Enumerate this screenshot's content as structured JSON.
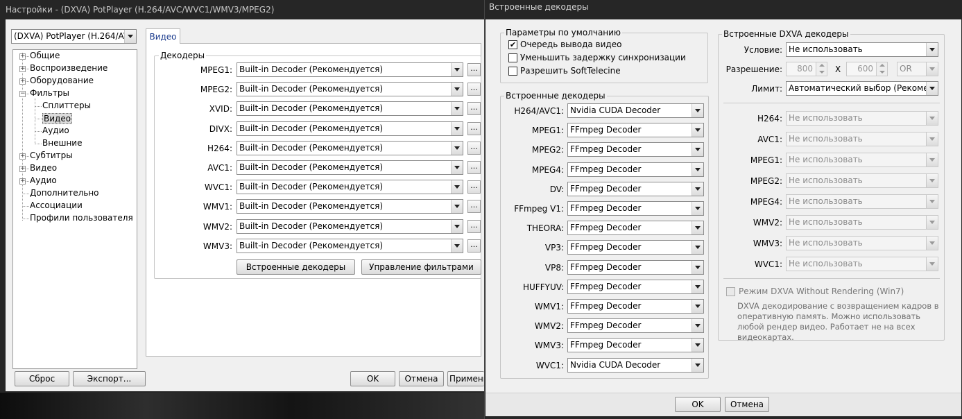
{
  "settings_window": {
    "title": "Настройки - (DXVA) PotPlayer (H.264/AVC/WVC1/WMV3/MPEG2)",
    "profile_select": "(DXVA) PotPlayer (H.264/AVC/",
    "tab_label": "Видео",
    "tree": [
      {
        "label": "Общие",
        "level": 0,
        "expander": "+"
      },
      {
        "label": "Воспроизведение",
        "level": 0,
        "expander": "+"
      },
      {
        "label": "Оборудование",
        "level": 0,
        "expander": "+"
      },
      {
        "label": "Фильтры",
        "level": 0,
        "expander": "-"
      },
      {
        "label": "Сплиттеры",
        "level": 1
      },
      {
        "label": "Видео",
        "level": 1,
        "selected": true
      },
      {
        "label": "Аудио",
        "level": 1
      },
      {
        "label": "Внешние",
        "level": 1
      },
      {
        "label": "Субтитры",
        "level": 0,
        "expander": "+"
      },
      {
        "label": "Видео",
        "level": 0,
        "expander": "+"
      },
      {
        "label": "Аудио",
        "level": 0,
        "expander": "+"
      },
      {
        "label": "Дополнительно",
        "level": 0
      },
      {
        "label": "Ассоциации",
        "level": 0
      },
      {
        "label": "Профили пользователя",
        "level": 0
      }
    ],
    "decoders_group": "Декодеры",
    "decoders": [
      {
        "label": "MPEG1:",
        "value": "Built-in Decoder (Рекомендуется)"
      },
      {
        "label": "MPEG2:",
        "value": "Built-in Decoder (Рекомендуется)"
      },
      {
        "label": "XVID:",
        "value": "Built-in Decoder (Рекомендуется)"
      },
      {
        "label": "DIVX:",
        "value": "Built-in Decoder (Рекомендуется)"
      },
      {
        "label": "H264:",
        "value": "Built-in Decoder (Рекомендуется)"
      },
      {
        "label": "AVC1:",
        "value": "Built-in Decoder (Рекомендуется)"
      },
      {
        "label": "WVC1:",
        "value": "Built-in Decoder (Рекомендуется)"
      },
      {
        "label": "WMV1:",
        "value": "Built-in Decoder (Рекомендуется)"
      },
      {
        "label": "WMV2:",
        "value": "Built-in Decoder (Рекомендуется)"
      },
      {
        "label": "WMV3:",
        "value": "Built-in Decoder (Рекомендуется)"
      }
    ],
    "dots_label": "...",
    "builtin_button": "Встроенные декодеры",
    "manage_button": "Управление фильтрами",
    "reset_button": "Сброс",
    "export_button": "Экспорт...",
    "ok_button": "OK",
    "cancel_button": "Отмена",
    "apply_button": "Применить"
  },
  "decoders_window": {
    "title": "Встроенные декодеры",
    "defaults_group": "Параметры по умолчанию",
    "options": [
      {
        "label": "Очередь вывода видео",
        "checked": true
      },
      {
        "label": "Уменьшить задержку синхронизации",
        "checked": false
      },
      {
        "label": "Разрешить SoftTelecine",
        "checked": false
      }
    ],
    "builtin_group": "Встроенные декодеры",
    "codecs": [
      {
        "label": "H264/AVC1:",
        "value": "Nvidia CUDA Decoder"
      },
      {
        "label": "MPEG1:",
        "value": "FFmpeg Decoder"
      },
      {
        "label": "MPEG2:",
        "value": "FFmpeg Decoder"
      },
      {
        "label": "MPEG4:",
        "value": "FFmpeg Decoder"
      },
      {
        "label": "DV:",
        "value": "FFmpeg Decoder"
      },
      {
        "label": "FFmpeg V1:",
        "value": "FFmpeg Decoder"
      },
      {
        "label": "THEORA:",
        "value": "FFmpeg Decoder"
      },
      {
        "label": "VP3:",
        "value": "FFmpeg Decoder"
      },
      {
        "label": "VP8:",
        "value": "FFmpeg Decoder"
      },
      {
        "label": "HUFFYUV:",
        "value": "FFmpeg Decoder"
      },
      {
        "label": "WMV1:",
        "value": "FFmpeg Decoder"
      },
      {
        "label": "WMV2:",
        "value": "FFmpeg Decoder"
      },
      {
        "label": "WMV3:",
        "value": "FFmpeg Decoder"
      },
      {
        "label": "WVC1:",
        "value": "Nvidia CUDA Decoder"
      }
    ],
    "dxva_group": "Встроенные DXVA декодеры",
    "condition_label": "Условие:",
    "condition_value": "Не использовать",
    "resolution_label": "Разрешение:",
    "res_width": "800",
    "res_x": "X",
    "res_height": "600",
    "res_op": "OR",
    "limit_label": "Лимит:",
    "limit_value": "Автоматический выбор (Рекомендуется)",
    "dxva_codecs": [
      {
        "label": "H264:",
        "value": "Не использовать"
      },
      {
        "label": "AVC1:",
        "value": "Не использовать"
      },
      {
        "label": "MPEG1:",
        "value": "Не использовать"
      },
      {
        "label": "MPEG2:",
        "value": "Не использовать"
      },
      {
        "label": "MPEG4:",
        "value": "Не использовать"
      },
      {
        "label": "WMV2:",
        "value": "Не использовать"
      },
      {
        "label": "WMV3:",
        "value": "Не использовать"
      },
      {
        "label": "WVC1:",
        "value": "Не использовать"
      }
    ],
    "dxva_wr_label": "Режим DXVA Without Rendering (Win7)",
    "dxva_wr_checked": false,
    "dxva_note": "DXVA декодирование с возвращением кадров в оперативную память. Можно использовать любой рендер видео. Работает не на всех видеокартах.",
    "ok_button": "OK",
    "cancel_button": "Отмена"
  }
}
